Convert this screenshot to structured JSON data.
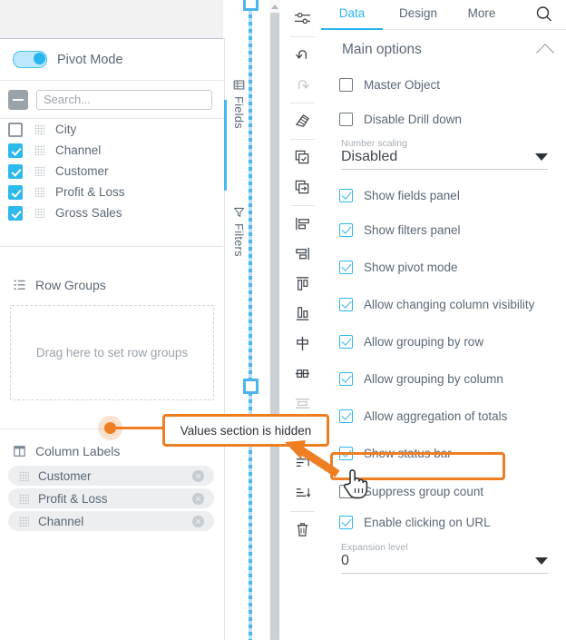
{
  "left_panel": {
    "pivot_mode_label": "Pivot Mode",
    "search_placeholder": "Search...",
    "fields": [
      {
        "label": "City",
        "checked": false
      },
      {
        "label": "Channel",
        "checked": true
      },
      {
        "label": "Customer",
        "checked": true
      },
      {
        "label": "Profit & Loss",
        "checked": true
      },
      {
        "label": "Gross Sales",
        "checked": true
      }
    ],
    "row_groups": {
      "title": "Row Groups",
      "dropzone_text": "Drag here to set row groups"
    },
    "column_labels": {
      "title": "Column Labels",
      "chips": [
        "Customer",
        "Profit & Loss",
        "Channel"
      ]
    }
  },
  "tab_rail": {
    "fields_label": "Fields",
    "filters_label": "Filters"
  },
  "icon_toolbar": {
    "items": [
      "settings-sliders-icon",
      "undo-icon",
      "redo-icon",
      "eraser-icon",
      "copy-check-icon",
      "copy-arrow-icon",
      "align-left-icon",
      "align-right-icon",
      "align-top-icon",
      "align-bottom-icon",
      "distribute-vertical-icon",
      "distribute-horizontal-icon",
      "stretch-icon",
      "chart-icon",
      "sort-up-icon",
      "sort-down-icon",
      "trash-icon"
    ]
  },
  "right_panel": {
    "tabs": [
      {
        "label": "Data",
        "active": true
      },
      {
        "label": "Design",
        "active": false
      },
      {
        "label": "More",
        "active": false
      }
    ],
    "search_icon": "search-icon",
    "section_title": "Main options",
    "options": [
      {
        "label": "Master Object",
        "checked": false
      },
      {
        "label": "Disable Drill down",
        "checked": false
      }
    ],
    "number_scaling": {
      "caption": "Number scaling",
      "value": "Disabled"
    },
    "options2": [
      {
        "label": "Show fields panel",
        "checked": true
      },
      {
        "label": "Show filters panel",
        "checked": true
      },
      {
        "label": "Show pivot mode",
        "checked": true
      },
      {
        "label": "Allow changing column visibility",
        "checked": true
      },
      {
        "label": "Allow grouping by row",
        "checked": true
      },
      {
        "label": "Allow grouping by column",
        "checked": true
      },
      {
        "label": "Allow aggregation of totals",
        "checked": true
      },
      {
        "label": "Show status bar",
        "checked": true
      },
      {
        "label": "Suppress group count",
        "checked": false
      },
      {
        "label": "Enable clicking on URL",
        "checked": true
      }
    ],
    "expansion_level": {
      "caption": "Expansion level",
      "value": "0"
    }
  },
  "annotation": {
    "callout_text": "Values section is hidden",
    "accent_color": "#ef7d22",
    "highlighted_option": "Allow aggregation of totals"
  },
  "colors": {
    "brand_blue": "#29b6ef",
    "checkbox_blue": "#2cb9ec",
    "text": "#5b6875",
    "annotation_orange": "#ef7d22"
  }
}
